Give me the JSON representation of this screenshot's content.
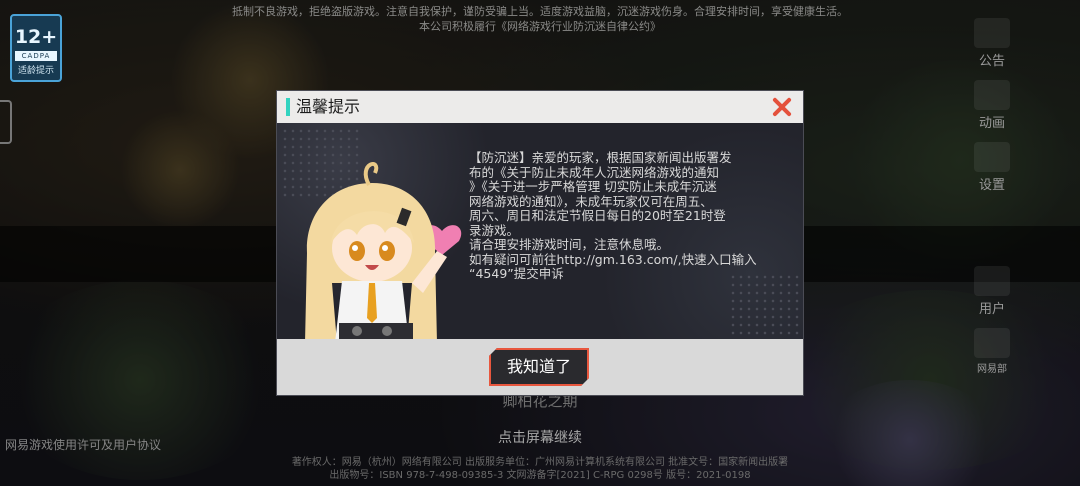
{
  "top_notice": {
    "line1": "抵制不良游戏，拒绝盗版游戏。注意自我保护，谨防受骗上当。适度游戏益脑，沉迷游戏伤身。合理安排时间，享受健康生活。",
    "line2": "本公司积极履行《网络游戏行业防沉迷自律公约》"
  },
  "age_badge": {
    "rating": "12+",
    "org": "CADPA",
    "caption": "适龄提示"
  },
  "side_menu": [
    {
      "label": "公告"
    },
    {
      "label": "动画"
    },
    {
      "label": "设置"
    },
    {
      "label": "用户"
    },
    {
      "label": "网易部"
    }
  ],
  "dialog": {
    "title": "温馨提示",
    "body_lines": [
      "【防沉迷】亲爱的玩家，根据国家新闻出版署发",
      "布的《关于防止未成年人沉迷网络游戏的通知",
      "》《关于进一步严格管理 切实防止未成年沉迷",
      "网络游戏的通知》，未成年玩家仅可在周五、",
      "周六、周日和法定节假日每日的20时至21时登",
      "录游戏。",
      "请合理安排游戏时间，注意休息哦。",
      "如有疑问可前往http://gm.163.com/,快速入口输入",
      "“4549”提交申诉"
    ],
    "confirm_label": "我知道了"
  },
  "under_title": "卿柏花之期",
  "tap_continue": "点击屏幕继续",
  "license_link": "网易游戏使用许可及用户协议",
  "copyright": {
    "line1": "著作权人：网易（杭州）网络有限公司 出版服务单位：广州网易计算机系统有限公司 批准文号：国家新闻出版署",
    "line2": "出版物号：ISBN 978-7-498-09385-3 文网游备字[2021] C-RPG 0298号 版号：2021-0198"
  },
  "colors": {
    "accent": "#32d3c0",
    "close": "#e4513c",
    "button_border": "#e8573e",
    "badge": "#4aa3d8"
  }
}
